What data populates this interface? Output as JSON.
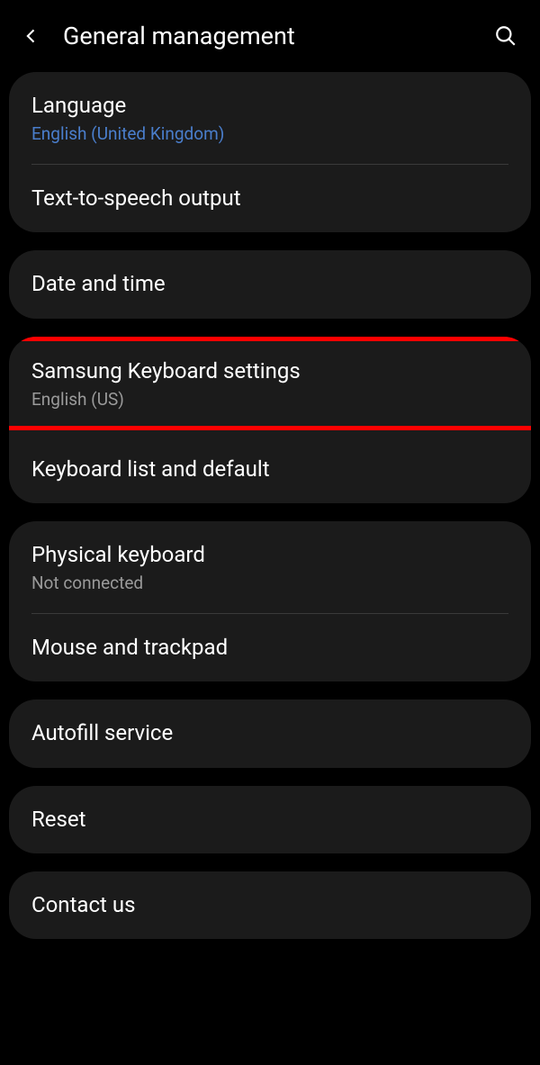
{
  "header": {
    "title": "General management"
  },
  "groups": [
    {
      "items": [
        {
          "title": "Language",
          "subtitle": "English (United Kingdom)",
          "subtitleAccent": true
        },
        {
          "title": "Text-to-speech output"
        }
      ]
    },
    {
      "items": [
        {
          "title": "Date and time"
        }
      ]
    },
    {
      "items": [
        {
          "title": "Samsung Keyboard settings",
          "subtitle": "English (US)",
          "highlighted": true
        },
        {
          "title": "Keyboard list and default"
        }
      ]
    },
    {
      "items": [
        {
          "title": "Physical keyboard",
          "subtitle": "Not connected"
        },
        {
          "title": "Mouse and trackpad"
        }
      ]
    },
    {
      "items": [
        {
          "title": "Autofill service"
        }
      ]
    },
    {
      "items": [
        {
          "title": "Reset"
        }
      ]
    },
    {
      "items": [
        {
          "title": "Contact us"
        }
      ]
    }
  ]
}
